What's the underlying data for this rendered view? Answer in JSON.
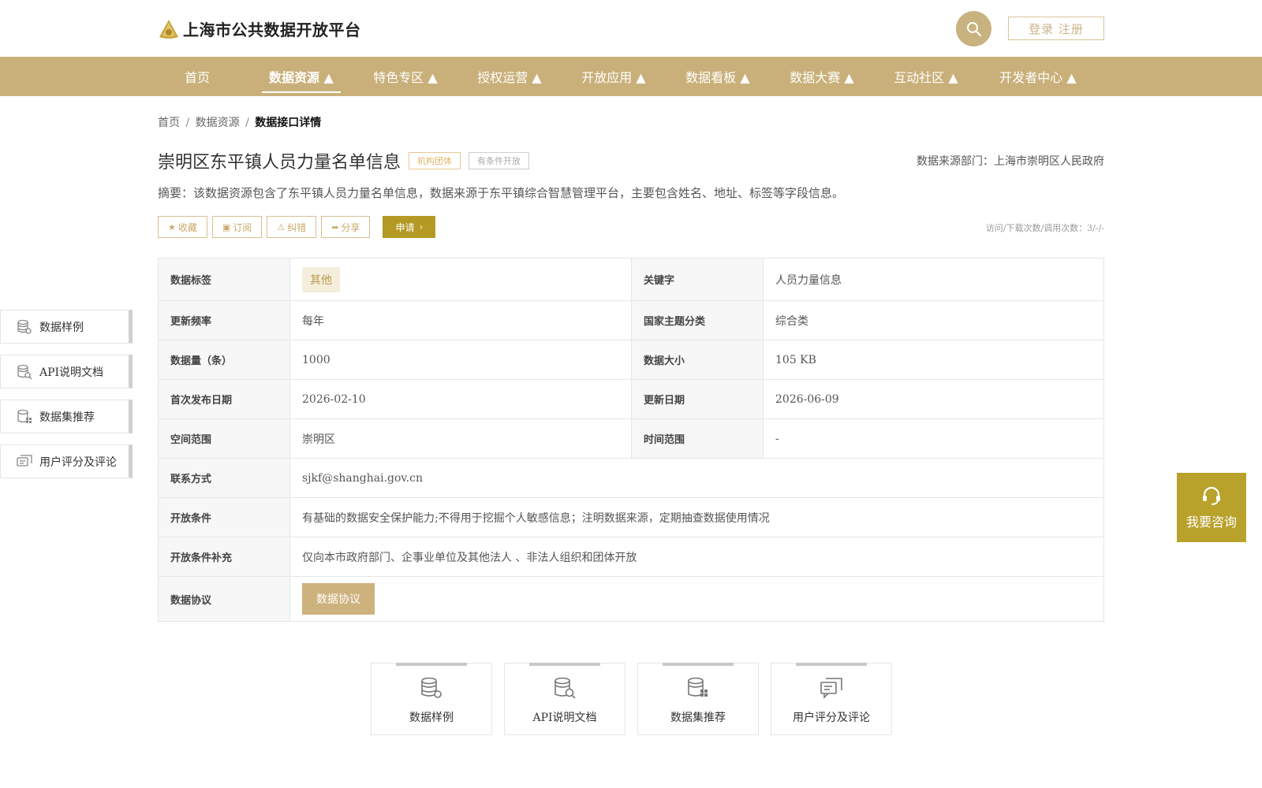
{
  "header": {
    "site_title": "上海市公共数据开放平台",
    "login_label": "登录 注册"
  },
  "nav": {
    "items": [
      {
        "label": "首页"
      },
      {
        "label": "数据资源 ▲"
      },
      {
        "label": "特色专区 ▲"
      },
      {
        "label": "授权运营 ▲"
      },
      {
        "label": "开放应用 ▲"
      },
      {
        "label": "数据看板 ▲"
      },
      {
        "label": "数据大赛 ▲"
      },
      {
        "label": "互动社区 ▲"
      },
      {
        "label": "开发者中心 ▲"
      }
    ],
    "active": "数据资源 ▲"
  },
  "breadcrumb": {
    "home": "首页",
    "resources": "数据资源",
    "current": "数据接口详情",
    "separator": "/"
  },
  "dataset": {
    "title": "崇明区东平镇人员力量名单信息",
    "tag_org": "机构团体",
    "tag_condition": "有条件开放",
    "source_dept": "数据来源部门：上海市崇明区人民政府",
    "summary": "摘要：该数据资源包含了东平镇人员力量名单信息，数据来源于东平镇综合智慧管理平台，主要包含姓名、地址、标签等字段信息。",
    "visit_count": "访问/下载次数/调用次数：3/-/-"
  },
  "actions": {
    "collect": "收藏",
    "subscribe": "订阅",
    "correct": "纠错",
    "share": "分享",
    "apply": "申请"
  },
  "info": {
    "tag_label": "数据标签",
    "tag_value": "其他",
    "keyword_label": "关键字",
    "keyword_value": "人员力量信息",
    "freq_label": "更新频率",
    "freq_value": "每年",
    "theme_label": "国家主题分类",
    "theme_value": "综合类",
    "count_label": "数据量（条）",
    "count_value": "1000",
    "size_label": "数据大小",
    "size_value": "105 KB",
    "first_pub_label": "首次发布日期",
    "first_pub_value": "2026-02-10",
    "update_label": "更新日期",
    "update_value": "2026-06-09",
    "space_label": "空间范围",
    "space_value": "崇明区",
    "time_label": "时间范围",
    "time_value": "-",
    "contact_label": "联系方式",
    "contact_value": "sjkf@shanghai.gov.cn",
    "cond_label": "开放条件",
    "cond_value": "有基础的数据安全保护能力;不得用于挖掘个人敏感信息；注明数据来源，定期抽查数据使用情况",
    "cond_extra_label": "开放条件补充",
    "cond_extra_value": "仅向本市政府部门、企事业单位及其他法人 、非法人组织和团体开放",
    "agreement_label": "数据协议",
    "agreement_button": "数据协议"
  },
  "side_menu": [
    {
      "label": "数据样例",
      "icon": "database-gear-icon"
    },
    {
      "label": "API说明文档",
      "icon": "database-search-icon"
    },
    {
      "label": "数据集推荐",
      "icon": "database-grid-icon"
    },
    {
      "label": "用户评分及评论",
      "icon": "comment-icon"
    }
  ],
  "consult": {
    "label": "我要咨询"
  },
  "cards": [
    {
      "label": "数据样例",
      "icon": "database-gear-icon"
    },
    {
      "label": "API说明文档",
      "icon": "database-search-icon"
    },
    {
      "label": "数据集推荐",
      "icon": "database-grid-icon"
    },
    {
      "label": "用户评分及评论",
      "icon": "comment-icon"
    }
  ],
  "colors": {
    "brand": "#c9b07a",
    "accent_dark": "#b49a25",
    "consult": "#b8a22c"
  }
}
